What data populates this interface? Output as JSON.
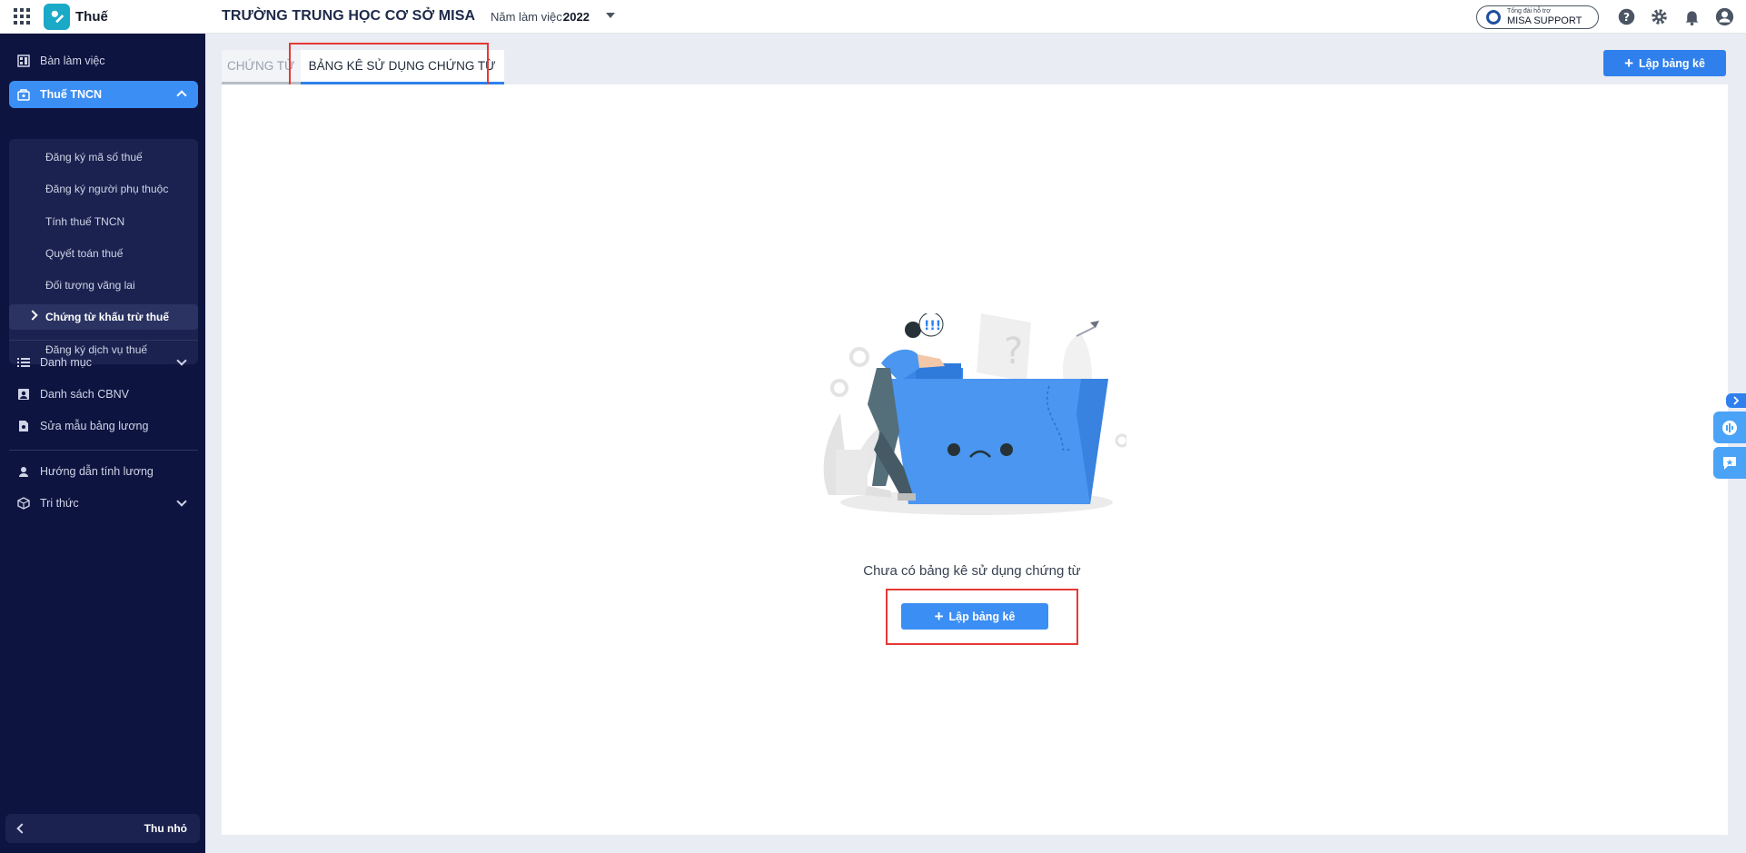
{
  "app": {
    "name": "Thuế"
  },
  "header": {
    "org_name": "TRƯỜNG TRUNG HỌC CƠ SỞ MISA",
    "year_label": "Năm làm việc:",
    "year_value": "2022",
    "support_small": "Tổng đài hỗ trợ",
    "support_big": "MISA SUPPORT"
  },
  "sidebar": {
    "items": [
      {
        "label": "Bàn làm việc",
        "icon": "dashboard-icon"
      },
      {
        "label": "Thuế TNCN",
        "icon": "tax-icon"
      }
    ],
    "sub_items": [
      {
        "label": "Đăng ký mã số thuế"
      },
      {
        "label": "Đăng ký người phụ thuộc"
      },
      {
        "label": "Tính thuế TNCN"
      },
      {
        "label": "Quyết toán thuế"
      },
      {
        "label": "Đối tượng vãng lai"
      },
      {
        "label": "Chứng từ khấu trừ thuế"
      },
      {
        "label": "Đăng ký dịch vụ thuế"
      }
    ],
    "group2": [
      {
        "label": "Danh mục",
        "icon": "list-icon"
      },
      {
        "label": "Danh sách CBNV",
        "icon": "employee-icon"
      },
      {
        "label": "Sửa mẫu bảng lương",
        "icon": "payroll-template-icon"
      }
    ],
    "group3": [
      {
        "label": "Hướng dẫn tính lương",
        "icon": "guide-icon"
      },
      {
        "label": "Tri thức",
        "icon": "knowledge-icon"
      }
    ],
    "collapse_label": "Thu nhỏ"
  },
  "tabs": [
    {
      "label": "CHỨNG TỪ"
    },
    {
      "label": "BẢNG KÊ SỬ DỤNG CHỨNG TỪ"
    }
  ],
  "toolbar": {
    "create_label": "Lập bảng kê"
  },
  "empty": {
    "message": "Chưa có bảng kê sử dụng chứng từ",
    "button_label": "Lập bảng kê"
  },
  "colors": {
    "accent": "#2f80ed",
    "sidebar_bg": "#0e1440",
    "highlight": "#e53935"
  }
}
